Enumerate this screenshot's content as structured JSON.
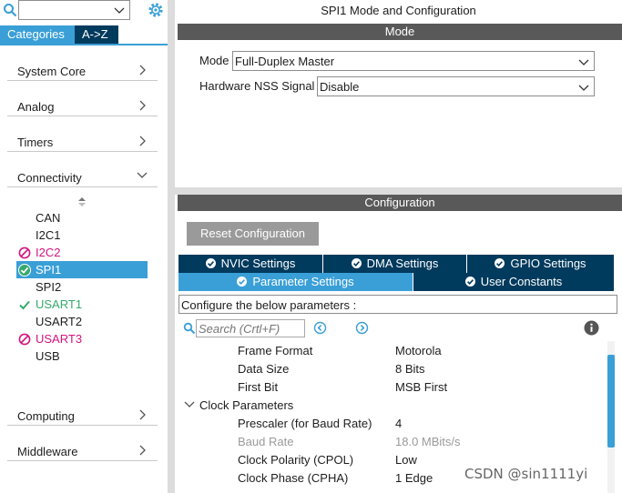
{
  "left": {
    "search": {
      "value": ""
    },
    "tabs": {
      "categories": "Categories",
      "az": "A->Z"
    },
    "categories": [
      {
        "label": "System Core",
        "expanded": false
      },
      {
        "label": "Analog",
        "expanded": false
      },
      {
        "label": "Timers",
        "expanded": false
      },
      {
        "label": "Connectivity",
        "expanded": true
      },
      {
        "label": "Computing",
        "expanded": false
      },
      {
        "label": "Middleware",
        "expanded": false
      }
    ],
    "peripherals": [
      {
        "label": "CAN",
        "status": "none"
      },
      {
        "label": "I2C1",
        "status": "none"
      },
      {
        "label": "I2C2",
        "status": "conflict"
      },
      {
        "label": "SPI1",
        "status": "configured",
        "selected": true
      },
      {
        "label": "SPI2",
        "status": "none"
      },
      {
        "label": "USART1",
        "status": "ok"
      },
      {
        "label": "USART2",
        "status": "none"
      },
      {
        "label": "USART3",
        "status": "conflict"
      },
      {
        "label": "USB",
        "status": "none"
      }
    ]
  },
  "right": {
    "title": "SPI1 Mode and Configuration",
    "mode_band": "Mode",
    "mode_label": "Mode",
    "mode_value": "Full-Duplex Master",
    "nss_label": "Hardware NSS Signal",
    "nss_value": "Disable",
    "config_band": "Configuration",
    "reset_button": "Reset Configuration",
    "tabs": {
      "nvic": "NVIC Settings",
      "dma": "DMA Settings",
      "gpio": "GPIO Settings",
      "params": "Parameter Settings",
      "user": "User Constants"
    },
    "configure_text": "Configure the below parameters :",
    "search_placeholder": "Search (Crtl+F)",
    "params": [
      {
        "key": "Frame Format",
        "value": "Motorola"
      },
      {
        "key": "Data Size",
        "value": "8 Bits"
      },
      {
        "key": "First Bit",
        "value": "MSB First"
      }
    ],
    "clock_group": "Clock Parameters",
    "clock_params": [
      {
        "key": "Prescaler (for Baud Rate)",
        "value": "4",
        "disabled": false
      },
      {
        "key": "Baud Rate",
        "value": "18.0 MBits/s",
        "disabled": true
      },
      {
        "key": "Clock Polarity (CPOL)",
        "value": "Low",
        "disabled": false
      },
      {
        "key": "Clock Phase (CPHA)",
        "value": "1 Edge",
        "disabled": false
      }
    ]
  },
  "watermark": "CSDN @sin1111yi",
  "colors": {
    "accent": "#3a9fd6",
    "dark_tab": "#003a5d",
    "band": "#595959",
    "green": "#35a96b",
    "magenta": "#d4147e"
  }
}
